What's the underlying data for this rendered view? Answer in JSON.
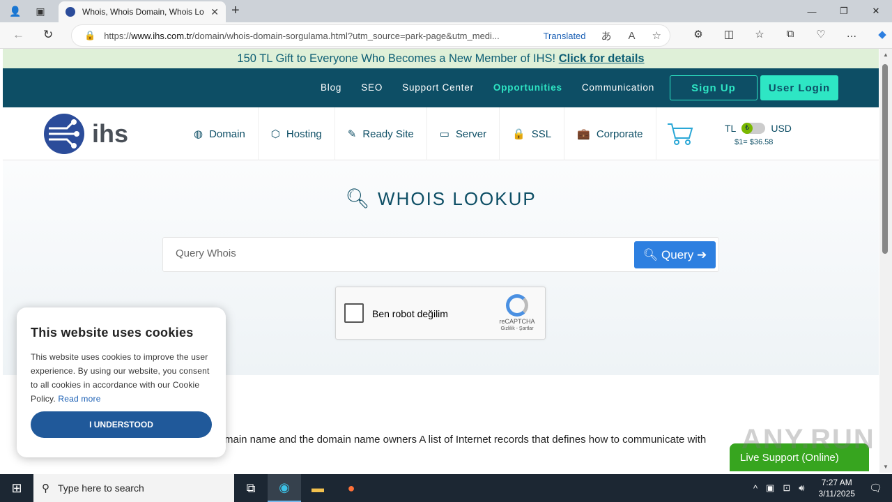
{
  "browser": {
    "tab_title": "Whois, Whois Domain, Whois Lo",
    "url_prefix": "https://",
    "url_host": "www.ihs.com.tr",
    "url_rest": "/domain/whois-domain-sorgulama.html?utm_source=park-page&utm_medi...",
    "translated_label": "Translated"
  },
  "promo": {
    "text": "150 TL Gift to Everyone Who Becomes a New Member of IHS!",
    "link": "Click for details"
  },
  "topnav": {
    "links": [
      "Blog",
      "SEO",
      "Support Center",
      "Opportunities",
      "Communication"
    ],
    "signup": "Sign Up",
    "login": "User Login"
  },
  "logo": {
    "word": "ihs"
  },
  "menu": [
    "Domain",
    "Hosting",
    "Ready Site",
    "Server",
    "SSL",
    "Corporate"
  ],
  "currency": {
    "left": "TL",
    "right": "USD",
    "rate": "$1= $36.58"
  },
  "hero": {
    "title": "WHOIS LOOKUP",
    "placeholder": "Query Whois",
    "button": "Query"
  },
  "captcha": {
    "label": "Ben robot değilim",
    "brand": "reCAPTCHA",
    "links": "Gizlilik - Şartlar"
  },
  "body": {
    "text": "main name and the domain name owners A list of Internet records that defines how to communicate with"
  },
  "cookie": {
    "title": "This website uses cookies",
    "text": "This website uses cookies to improve the user experience. By using our website, you consent to all cookies in accordance with our Cookie Policy.",
    "link": "Read more",
    "button": "I UNDERSTOOD"
  },
  "live": {
    "label": "Live Support (Online)"
  },
  "watermark": "ANY.RUN",
  "taskbar": {
    "search_placeholder": "Type here to search",
    "time": "7:27 AM",
    "date": "3/11/2025"
  }
}
